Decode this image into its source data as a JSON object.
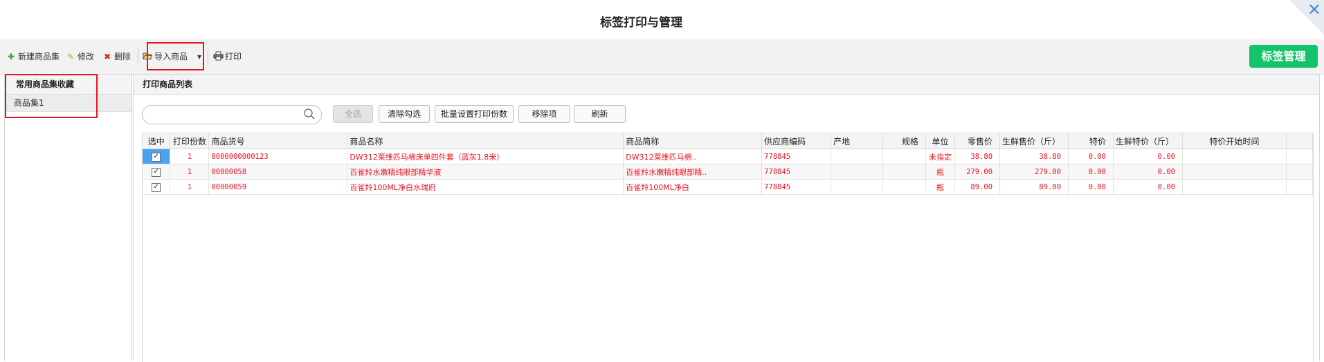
{
  "window": {
    "title": "标签打印与管理",
    "close_glyph": "✕"
  },
  "toolbar": {
    "new_label": "新建商品集",
    "edit_label": "修改",
    "delete_label": "删除",
    "import_label": "导入商品",
    "print_label": "打印",
    "tag_manage_label": "标签管理"
  },
  "left_panel": {
    "header": "常用商品集收藏",
    "items": [
      {
        "label": "商品集1"
      }
    ]
  },
  "right_panel": {
    "header": "打印商品列表",
    "search": {
      "value": "",
      "placeholder": ""
    },
    "buttons": {
      "select_all": "全选",
      "clear_selection": "清除勾选",
      "batch_copies": "批量设置打印份数",
      "remove": "移除项",
      "refresh": "刷新"
    }
  },
  "table": {
    "columns": [
      "选中",
      "打印份数",
      "商品货号",
      "商品名称",
      "商品简称",
      "供应商编码",
      "产地",
      "规格",
      "单位",
      "零售价",
      "生鲜售价（斤）",
      "特价",
      "生鲜特价（斤）",
      "特价开始时间"
    ],
    "rows": [
      {
        "copies": "1",
        "sku": "0000000000123",
        "name": "DW312莱维匹马棉床单四件套（蓝灰1.8米）",
        "short": "DW312莱维匹马棉..",
        "supplier": "778845",
        "origin": "",
        "spec": "",
        "unit": "未指定",
        "price": "38.80",
        "fresh_price": "38.80",
        "special": "0.00",
        "fresh_special": "0.00",
        "special_start": ""
      },
      {
        "copies": "1",
        "sku": "00000058",
        "name": "百雀羚水嫩精纯眼部精华液",
        "short": "百雀羚水嫩精纯眼部精..",
        "supplier": "778845",
        "origin": "",
        "spec": "",
        "unit": "瓶",
        "price": "279.00",
        "fresh_price": "279.00",
        "special": "0.00",
        "fresh_special": "0.00",
        "special_start": ""
      },
      {
        "copies": "1",
        "sku": "00000059",
        "name": "百雀羚100ML净白水瑞府",
        "short": "百雀羚100ML净白",
        "supplier": "778845",
        "origin": "",
        "spec": "",
        "unit": "瓶",
        "price": "89.00",
        "fresh_price": "89.00",
        "special": "0.00",
        "fresh_special": "0.00",
        "special_start": ""
      }
    ]
  },
  "colors": {
    "accent_green": "#13c46b",
    "row_text_red": "#e8141f",
    "highlight_red": "#e8141f",
    "close_blue": "#4a8bd6"
  }
}
